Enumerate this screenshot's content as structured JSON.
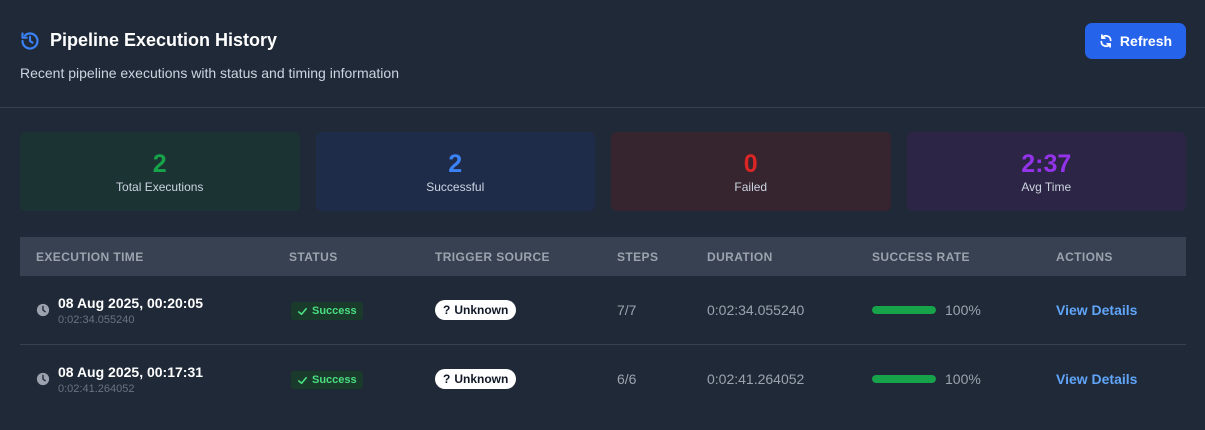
{
  "header": {
    "title": "Pipeline Execution History",
    "subtitle": "Recent pipeline executions with status and timing information",
    "refresh_label": "Refresh",
    "title_icon": "history-icon",
    "refresh_icon": "sync-icon"
  },
  "stats": [
    {
      "value": "2",
      "label": "Total Executions",
      "color": "#16a34a"
    },
    {
      "value": "2",
      "label": "Successful",
      "color": "#3b82f6"
    },
    {
      "value": "0",
      "label": "Failed",
      "color": "#dc2626"
    },
    {
      "value": "2:37",
      "label": "Avg Time",
      "color": "#9333ea"
    }
  ],
  "table": {
    "columns": [
      "EXECUTION TIME",
      "STATUS",
      "TRIGGER SOURCE",
      "STEPS",
      "DURATION",
      "SUCCESS RATE",
      "ACTIONS"
    ],
    "rows": [
      {
        "time": "08 Aug 2025, 00:20:05",
        "time_sub": "0:02:34.055240",
        "status": "Success",
        "trigger": "Unknown",
        "steps": "7/7",
        "duration": "0:02:34.055240",
        "success_rate": "100%",
        "success_fraction": 1.0,
        "action": "View Details"
      },
      {
        "time": "08 Aug 2025, 00:17:31",
        "time_sub": "0:02:41.264052",
        "status": "Success",
        "trigger": "Unknown",
        "steps": "6/6",
        "duration": "0:02:41.264052",
        "success_rate": "100%",
        "success_fraction": 1.0,
        "action": "View Details"
      }
    ]
  }
}
